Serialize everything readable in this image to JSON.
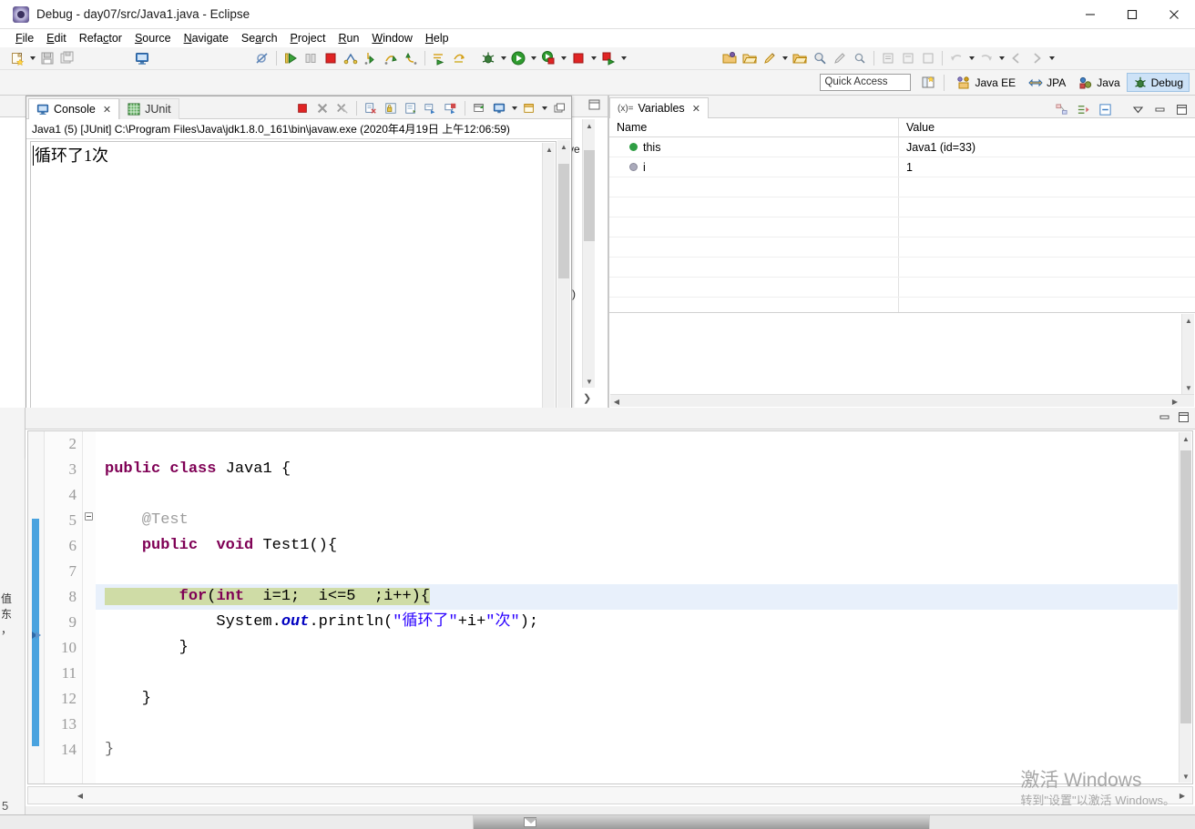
{
  "window": {
    "title": "Debug - day07/src/Java1.java - Eclipse",
    "icon": "eclipse-icon",
    "controls": {
      "minimize": "minimize-icon",
      "maximize": "maximize-icon",
      "close": "close-icon"
    }
  },
  "menubar": {
    "items": [
      {
        "label": "File",
        "mnemonic": "F"
      },
      {
        "label": "Edit",
        "mnemonic": "E"
      },
      {
        "label": "Refactor",
        "mnemonic": "c"
      },
      {
        "label": "Source",
        "mnemonic": "S"
      },
      {
        "label": "Navigate",
        "mnemonic": "N"
      },
      {
        "label": "Search",
        "mnemonic": "a"
      },
      {
        "label": "Project",
        "mnemonic": "P"
      },
      {
        "label": "Run",
        "mnemonic": "R"
      },
      {
        "label": "Window",
        "mnemonic": "W"
      },
      {
        "label": "Help",
        "mnemonic": "H"
      }
    ]
  },
  "toolbar": {
    "buttons": [
      "new-wizard-icon",
      "new-dropdown-arrow",
      "save-icon",
      "save-all-icon",
      "print-screen-icon",
      "skip-breakpoints-icon",
      "resume-icon",
      "suspend-icon",
      "terminate-icon",
      "disconnect-icon",
      "step-into-icon",
      "step-over-icon",
      "step-return-icon",
      "drop-to-frame-icon",
      "use-step-filters-icon",
      "debug-icon",
      "debug-dropdown-arrow",
      "run-icon",
      "run-dropdown-arrow",
      "coverage-icon",
      "coverage-dropdown-arrow",
      "stop-icon",
      "stop-dropdown-arrow",
      "external-tools-icon",
      "external-tools-dropdown-arrow",
      "new-java-package-icon",
      "open-type-icon",
      "new-class-icon",
      "new-class-dropdown-arrow",
      "open-task-icon",
      "search-icon",
      "pen-icon",
      "annotation-icon",
      "back-icon",
      "back-dropdown-arrow",
      "forward-icon",
      "forward-dropdown-arrow",
      "previous-annotation-icon",
      "next-annotation-icon",
      "last-edit-icon",
      "forward-nav-icon"
    ]
  },
  "quick_access": {
    "placeholder": "Quick Access"
  },
  "perspectives": {
    "open_perspective_icon": "open-perspective-icon",
    "items": [
      {
        "label": "Java EE",
        "icon": "java-ee-icon",
        "active": false
      },
      {
        "label": "JPA",
        "icon": "jpa-icon",
        "active": false
      },
      {
        "label": "Java",
        "icon": "java-icon",
        "active": false
      },
      {
        "label": "Debug",
        "icon": "debug-perspective-icon",
        "active": true
      }
    ]
  },
  "fastview": {
    "items": [
      {
        "name": "restore-icon"
      },
      {
        "name": "console-icon",
        "selected": true
      },
      {
        "name": "junit-icon",
        "selected": false
      }
    ]
  },
  "console_view": {
    "tabs": [
      {
        "label": "Console",
        "icon": "console-icon",
        "active": true,
        "closable": true
      },
      {
        "label": "JUnit",
        "icon": "junit-icon",
        "active": false,
        "closable": false
      }
    ],
    "toolbar": [
      "terminate-icon",
      "remove-launch-icon",
      "remove-all-launches-icon",
      "clear-console-icon",
      "scroll-lock-icon",
      "word-wrap-icon",
      "show-console-on-output-icon",
      "show-console-on-error-icon",
      "pin-console-icon",
      "display-selected-console-icon",
      "display-console-dropdown-arrow",
      "open-console-icon",
      "open-console-dropdown-arrow",
      "restore-icon"
    ],
    "launch_line": "Java1 (5) [JUnit] C:\\Program Files\\Java\\jdk1.8.0_161\\bin\\javaw.exe (2020年4月19日 上午12:06:59)",
    "output": "循环了1次"
  },
  "debug_view_behind": {
    "fragment_1": "ve",
    "fragment_2": "r)"
  },
  "variables_view": {
    "tab": {
      "label": "Variables",
      "icon": "variables-icon",
      "closable": true
    },
    "toolbar": [
      "show-logical-structure-icon",
      "collapse-all-icon",
      "view-menu-icon",
      "minimize-icon",
      "maximize-icon"
    ],
    "columns": [
      "Name",
      "Value"
    ],
    "rows": [
      {
        "name": "this",
        "value": "Java1  (id=33)",
        "marker": "object-marker",
        "marker_color": "#2f9e44"
      },
      {
        "name": "i",
        "value": "1",
        "marker": "primitive-marker",
        "marker_color": "#7a7a7a"
      }
    ]
  },
  "editor": {
    "filename": "Java1.java",
    "controls": [
      "minimize-icon",
      "maximize-icon"
    ],
    "lines": [
      {
        "num": "2",
        "tokens": []
      },
      {
        "num": "3",
        "tokens": [
          {
            "t": "public",
            "c": "kw"
          },
          {
            "t": " ",
            "c": "plain"
          },
          {
            "t": "class",
            "c": "kw"
          },
          {
            "t": " Java1 {",
            "c": "plain"
          }
        ]
      },
      {
        "num": "4",
        "tokens": []
      },
      {
        "num": "5",
        "fold": true,
        "tokens": [
          {
            "t": "    @Test",
            "c": "ann"
          }
        ]
      },
      {
        "num": "6",
        "tokens": [
          {
            "t": "    ",
            "c": "plain"
          },
          {
            "t": "public",
            "c": "kw"
          },
          {
            "t": "  ",
            "c": "plain"
          },
          {
            "t": "void",
            "c": "kw"
          },
          {
            "t": " Test1(){",
            "c": "plain"
          }
        ]
      },
      {
        "num": "7",
        "tokens": []
      },
      {
        "num": "8",
        "current": true,
        "tokens": [
          {
            "t": "        ",
            "c": "plain"
          },
          {
            "t": "for",
            "c": "kw"
          },
          {
            "t": "(",
            "c": "plain"
          },
          {
            "t": "int",
            "c": "kw"
          },
          {
            "t": "  i=1;  i<=5  ;i++){",
            "c": "plain"
          }
        ]
      },
      {
        "num": "9",
        "tokens": [
          {
            "t": "            System.",
            "c": "plain"
          },
          {
            "t": "out",
            "c": "fld"
          },
          {
            "t": ".println(",
            "c": "plain"
          },
          {
            "t": "\"循环了\"",
            "c": "str"
          },
          {
            "t": "+i+",
            "c": "plain"
          },
          {
            "t": "\"次\"",
            "c": "str"
          },
          {
            "t": ");",
            "c": "plain"
          }
        ]
      },
      {
        "num": "10",
        "tokens": [
          {
            "t": "        }",
            "c": "plain"
          }
        ]
      },
      {
        "num": "11",
        "tokens": []
      },
      {
        "num": "12",
        "tokens": [
          {
            "t": "    }",
            "c": "plain"
          }
        ]
      },
      {
        "num": "13",
        "tokens": []
      },
      {
        "num": "14",
        "tokens": [
          {
            "t": "}",
            "c": "plain"
          }
        ]
      }
    ]
  },
  "watermark": {
    "line1": "激活 Windows",
    "line2": "转到\"设置\"以激活 Windows。"
  },
  "colors": {
    "accent": "#cde2f7",
    "keyword": "#7f0055",
    "string": "#2a00ff",
    "annotation": "#9d9d9d",
    "field": "#0000c0",
    "current_line_highlight": "#cfdca6",
    "row_highlight": "#e8f0fb",
    "titlebar_bg": "#ffffff",
    "toolbar_bg": "#f4f4f4"
  }
}
